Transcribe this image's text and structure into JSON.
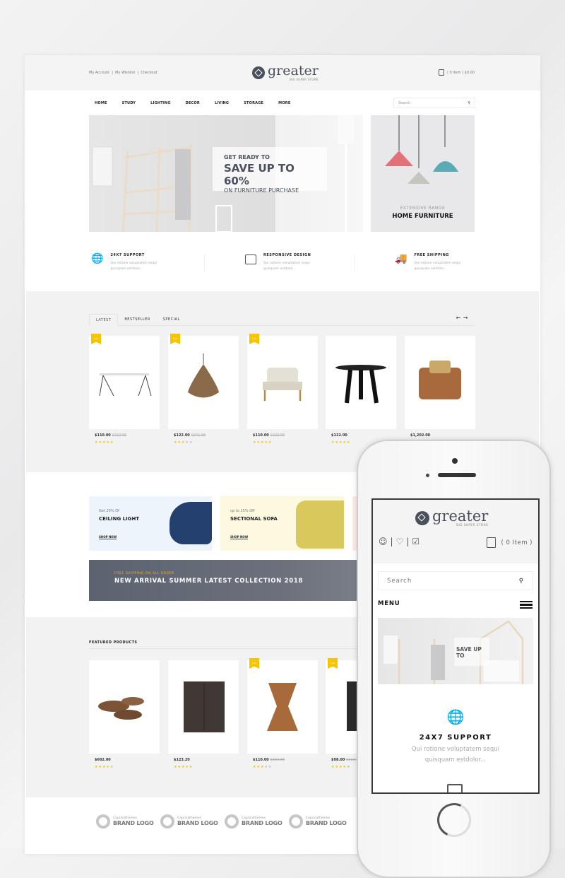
{
  "header": {
    "links": [
      "My Account",
      "My Wishlist",
      "Checkout"
    ],
    "logo": "greater",
    "tagline": "BIG SUPER STORE",
    "cart": "( 0 item ) $0.00"
  },
  "nav": {
    "items": [
      "HOME",
      "STUDY",
      "LIGHTING",
      "DECOR",
      "LIVING",
      "STORAGE",
      "MORE"
    ],
    "search_placeholder": "Search"
  },
  "hero": {
    "line1": "GET READY TO",
    "line2": "SAVE UP TO 60%",
    "line3": "ON FURNITURE PURCHASE"
  },
  "side_banner": {
    "sub": "EXTENSIVE RANGE",
    "title": "HOME FURNITURE"
  },
  "features": [
    {
      "title": "24X7 SUPPORT",
      "text": "Qui rotione voluptatem sequi quisquam estdolor...",
      "icon": "globe-support-icon"
    },
    {
      "title": "RESPONSIVE DESIGN",
      "text": "Qui rotione voluptatem sequi quisquam estdolor...",
      "icon": "devices-icon"
    },
    {
      "title": "FREE SHIPPING",
      "text": "Qui rotione voluptatem sequi quisquam estdolor...",
      "icon": "truck-icon"
    }
  ],
  "tabs": [
    "LATEST",
    "BESTSELLER",
    "SPECIAL"
  ],
  "latest": [
    {
      "badge": "10%",
      "price": "$110.00",
      "old": "$122.00",
      "rating": 5,
      "item": "table"
    },
    {
      "badge": "50%",
      "price": "$122.00",
      "old": "$241.99",
      "rating": 3,
      "item": "lamp"
    },
    {
      "badge": "10%",
      "price": "$110.00",
      "old": "$122.00",
      "rating": 5,
      "item": "armchair"
    },
    {
      "badge": "",
      "price": "$122.00",
      "old": "",
      "rating": 5,
      "item": "stool"
    },
    {
      "badge": "",
      "price": "$1,202.00",
      "old": "",
      "rating": 0,
      "item": "sofa-chair"
    }
  ],
  "promos": [
    {
      "sub": "Get 20% Of",
      "title": "CEILING LIGHT",
      "link": "SHOP NOW",
      "bg": "#eef4fc"
    },
    {
      "sub": "up to 15% Off",
      "title": "SECTIONAL SOFA",
      "link": "SHOP NOW",
      "bg": "#fdf9e1"
    }
  ],
  "arrival": {
    "sub": "FREE SHIPPING ON ALL ORDER",
    "title": "NEW ARRIVAL SUMMER LATEST COLLECTION 2018"
  },
  "featured": {
    "title": "FEATURED PRODUCTS",
    "items": [
      {
        "badge": "",
        "price": "$602.00",
        "old": "",
        "rating": 4
      },
      {
        "badge": "",
        "price": "$123.20",
        "old": "",
        "rating": 5
      },
      {
        "badge": "10%",
        "price": "$110.00",
        "old": "$122.00",
        "rating": 3
      },
      {
        "badge": "10%",
        "price": "$98.00",
        "old": "$122.00",
        "rating": 4
      }
    ]
  },
  "brands": [
    {
      "small": "Capricathemes",
      "big": "BRAND LOGO"
    },
    {
      "small": "Capricathemes",
      "big": "BRAND LOGO"
    },
    {
      "small": "Capricathemes",
      "big": "BRAND LOGO"
    },
    {
      "small": "Capricathemes",
      "big": "BRAND LOGO"
    }
  ],
  "mobile": {
    "logo": "greater",
    "tagline": "BIG SUPER STORE",
    "cart": "( 0 Item )",
    "search_placeholder": "Search",
    "menu": "MENU",
    "hero_text": "SAVE UP TO",
    "feature_title": "24X7 SUPPORT",
    "feature_text": "Qui rotione voluptatem sequi quisquam estdolor..."
  },
  "colors": {
    "accent": "#f6c500",
    "dark": "#4a505c"
  }
}
